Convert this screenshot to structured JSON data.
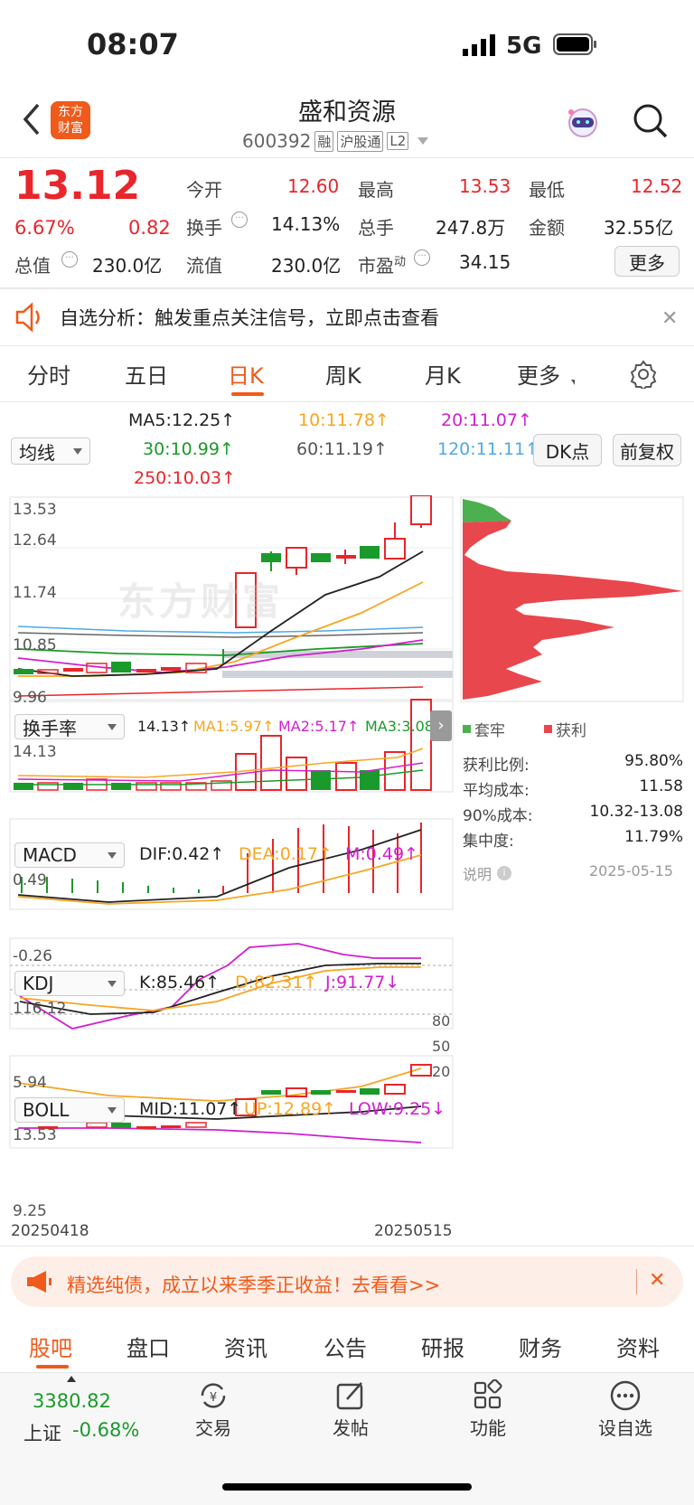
{
  "status_bar": {
    "time": "08:07",
    "network": "5G"
  },
  "header": {
    "title": "盛和资源",
    "code": "600392",
    "badges": [
      "融",
      "沪股通",
      "L2"
    ],
    "logo_text": "东方\n财富"
  },
  "quote": {
    "price": "13.12",
    "change_pct": "6.67%",
    "change": "0.82",
    "open_label": "今开",
    "open": "12.60",
    "high_label": "最高",
    "high": "13.53",
    "low_label": "最低",
    "low": "12.52",
    "turnover_label": "换手",
    "turnover": "14.13%",
    "volume_label": "总手",
    "volume": "247.8万",
    "amount_label": "金额",
    "amount": "32.55亿",
    "mktcap_label": "总值",
    "mktcap": "230.0亿",
    "float_label": "流值",
    "float": "230.0亿",
    "pe_label": "市盈",
    "pe_sup": "动",
    "pe": "34.15",
    "more_button": "更多"
  },
  "notice": {
    "text": "自选分析：触发重点关注信号，立即点击查看"
  },
  "chart_tabs": [
    "分时",
    "五日",
    "日K",
    "周K",
    "月K",
    "更多"
  ],
  "active_tab": 2,
  "ma": {
    "selector": "均线",
    "ma5": "MA5:12.25↑",
    "ma10": "10:11.78↑",
    "ma20": "20:11.07↑",
    "ma30": "30:10.99↑",
    "ma60": "60:11.19↑",
    "ma120": "120:11.11↑",
    "ma250": "250:10.03↑",
    "dk_button": "DK点",
    "adjust_button": "前复权"
  },
  "kline_axis": [
    "13.53",
    "12.64",
    "11.74",
    "10.85",
    "9.96"
  ],
  "watermark": "东方财富",
  "turnover_panel": {
    "selector": "换手率",
    "value": "14.13↑",
    "ma1": "MA1:5.97↑",
    "ma2": "MA2:5.17↑",
    "ma3": "MA3:3.08",
    "axis_top": "14.13"
  },
  "macd_panel": {
    "selector": "MACD",
    "dif": "DIF:0.42↑",
    "dea": "DEA:0.17↑",
    "m": "M:0.49↑",
    "axis_top": "0.49",
    "axis_bottom": "-0.26"
  },
  "kdj_panel": {
    "selector": "KDJ",
    "k": "K:85.46↑",
    "d": "D:82.31↑",
    "j": "J:91.77↓",
    "axis_top": "116.12",
    "axis_bottom": "5.94",
    "levels": [
      "80",
      "50",
      "20"
    ]
  },
  "boll_panel": {
    "selector": "BOLL",
    "mid": "MID:11.07↑",
    "up": "UP:12.89↑",
    "low": "LOW:9.25↓",
    "axis_top": "13.53",
    "axis_bottom": "9.25"
  },
  "date_start": "20250418",
  "date_end": "20250515",
  "chip": {
    "legend_trapped": "套牢",
    "legend_profit": "获利",
    "rows": [
      {
        "label": "获利比例:",
        "value": "95.80%"
      },
      {
        "label": "平均成本:",
        "value": "11.58"
      },
      {
        "label": "90%成本:",
        "value": "10.32-13.08"
      },
      {
        "label": "集中度:",
        "value": "11.79%"
      }
    ],
    "note_label": "说明",
    "note_date": "2025-05-15"
  },
  "ad": {
    "text": "精选纯债，成立以来季季正收益！去看看>>"
  },
  "bottom_tabs": [
    "股吧",
    "盘口",
    "资讯",
    "公告",
    "研报",
    "财务",
    "资料"
  ],
  "index": {
    "value": "3380.82",
    "name": "上证",
    "change": "-0.68%"
  },
  "actions": [
    {
      "label": "交易",
      "icon": "yen-refresh-icon"
    },
    {
      "label": "发帖",
      "icon": "edit-icon"
    },
    {
      "label": "功能",
      "icon": "grid-icon"
    },
    {
      "label": "设自选",
      "icon": "dots-icon"
    }
  ],
  "colors": {
    "up": "#e8262b",
    "down": "#1a9a2a",
    "accent": "#f05a1a"
  }
}
